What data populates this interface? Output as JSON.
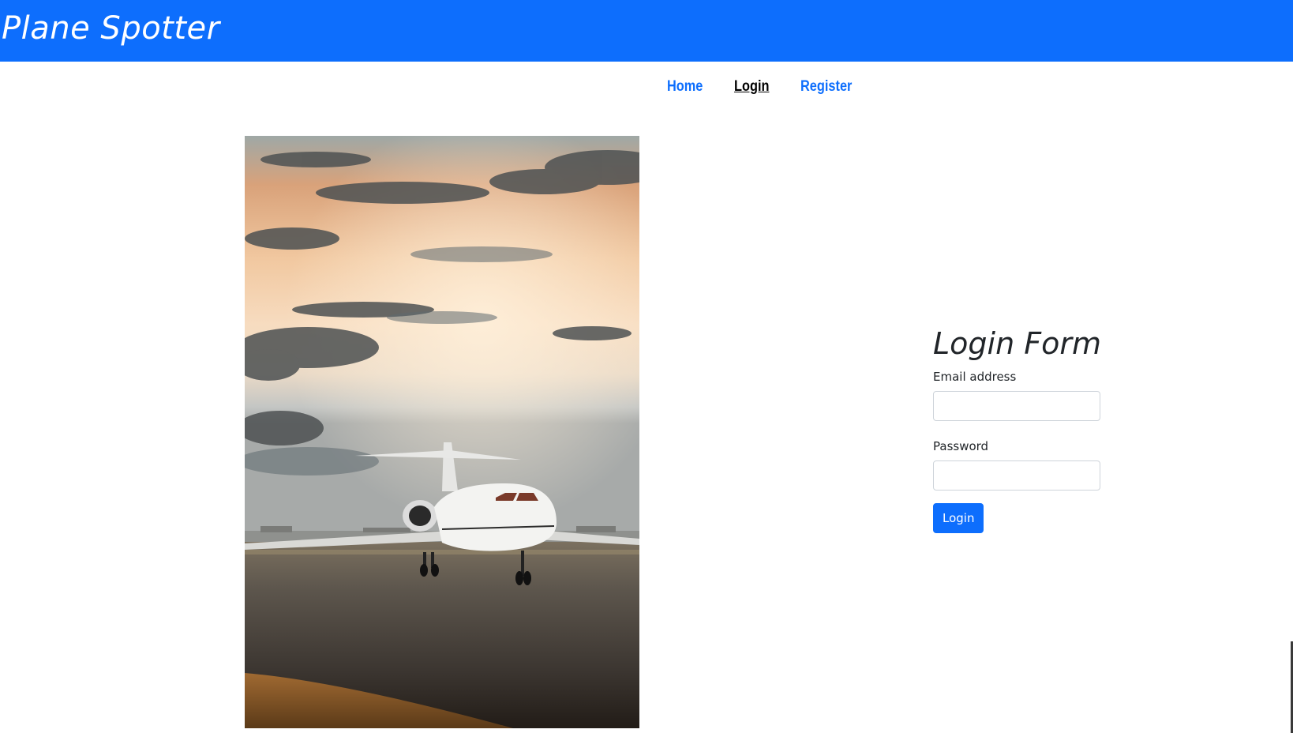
{
  "header": {
    "brand": "Plane Spotter",
    "color": "#0d6efd"
  },
  "nav": {
    "items": [
      {
        "label": "Home",
        "active": false
      },
      {
        "label": "Login",
        "active": true
      },
      {
        "label": "Register",
        "active": false
      }
    ]
  },
  "hero_image": {
    "subject": "business-jet-on-runway-at-sunset"
  },
  "login_form": {
    "title": "Login Form",
    "email_label": "Email address",
    "email_value": "",
    "password_label": "Password",
    "password_value": "",
    "submit_label": "Login"
  }
}
